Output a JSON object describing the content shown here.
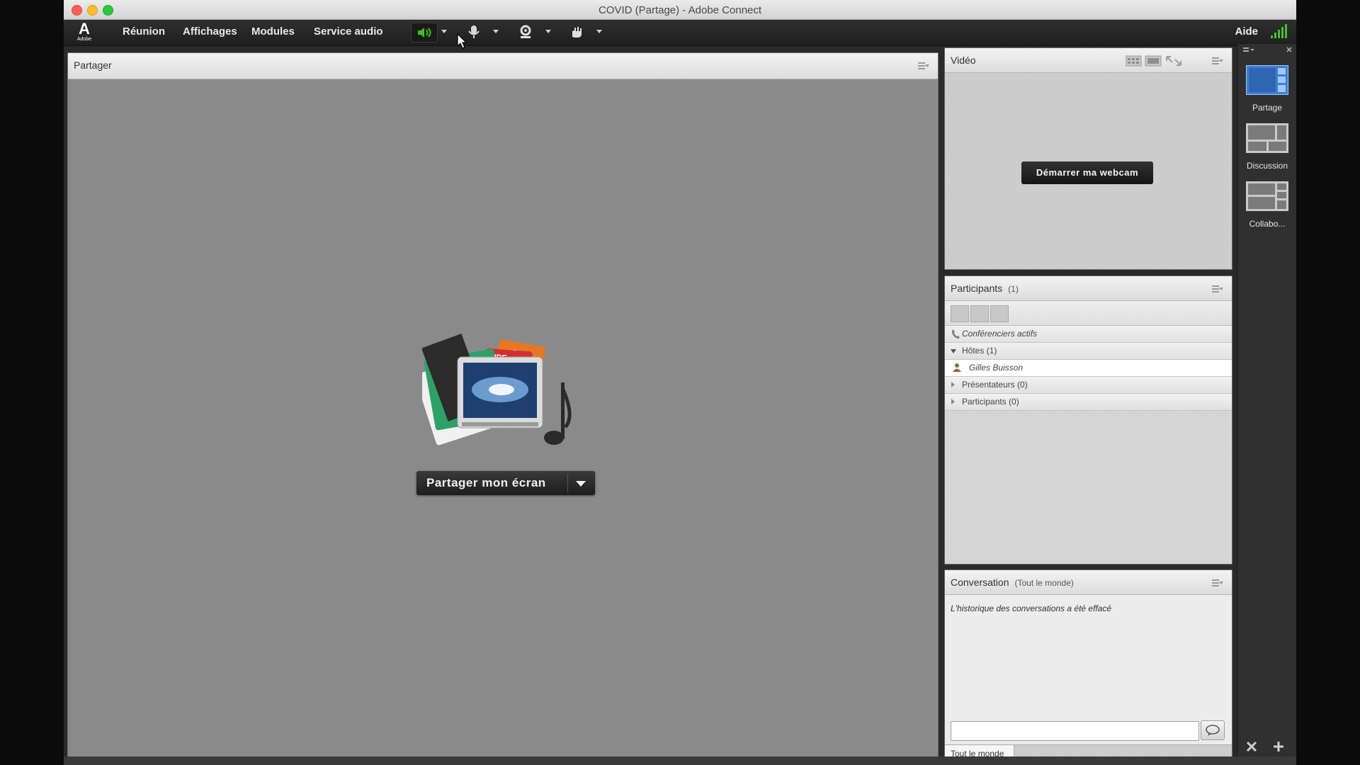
{
  "window": {
    "title": "COVID (Partage) - Adobe Connect"
  },
  "logo": {
    "text": "A",
    "subtext": "Adobe"
  },
  "menu": {
    "items": [
      "Réunion",
      "Affichages",
      "Modules",
      "Service audio"
    ],
    "help": "Aide"
  },
  "toolbar": {
    "icons": [
      "speaker-icon",
      "microphone-icon",
      "webcam-icon",
      "raise-hand-icon"
    ],
    "speaker_color": "#3fbf2a"
  },
  "share_pod": {
    "title": "Partager",
    "button_label": "Partager mon écran",
    "art_labels": [
      "PPT",
      "PDF"
    ]
  },
  "video_pod": {
    "title": "Vidéo",
    "webcam_button": "Démarrer ma webcam"
  },
  "participants_pod": {
    "title": "Participants",
    "count": "(1)",
    "active_speakers": "Conférenciers actifs",
    "groups": [
      {
        "label": "Hôtes (1)",
        "expanded": true
      },
      {
        "label": "Présentateurs (0)",
        "expanded": false
      },
      {
        "label": "Participants (0)",
        "expanded": false
      }
    ],
    "host_user": "Gilles Buisson"
  },
  "chat_pod": {
    "title": "Conversation",
    "scope": "(Tout le monde)",
    "message": "L'historique des conversations a été effacé",
    "input_value": "",
    "target": "Tout le monde"
  },
  "layouts": {
    "items": [
      {
        "label": "Partage",
        "active": true
      },
      {
        "label": "Discussion",
        "active": false
      },
      {
        "label": "Collabo...",
        "active": false
      }
    ]
  },
  "colors": {
    "accent_blue": "#3d7fd6",
    "signal_green": "#43c22b"
  }
}
